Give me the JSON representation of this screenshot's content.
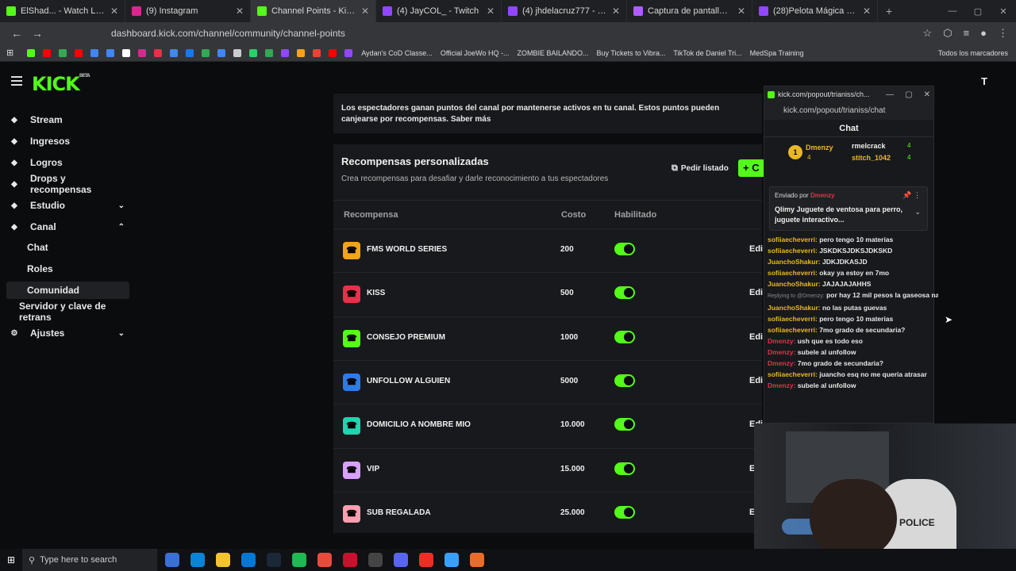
{
  "browser": {
    "tabs": [
      {
        "title": "ElShad... - Watch Live on",
        "fav": "#53fc18"
      },
      {
        "title": "(9) Instagram",
        "fav": "#d6298f"
      },
      {
        "title": "Channel Points - Kick Dashboar",
        "fav": "#53fc18"
      },
      {
        "title": "(4) JayCOL_ - Twitch",
        "fav": "#9146ff"
      },
      {
        "title": "(4) jhdelacruz777 - Twitch",
        "fav": "#9146ff"
      },
      {
        "title": "Captura de pantalla por Lightsh",
        "fav": "#b05cff"
      },
      {
        "title": "(28)Pelota Mágica para Perros",
        "fav": "#9146ff"
      }
    ],
    "url": "dashboard.kick.com/channel/community/channel-points",
    "bookmarks": [
      "Aydan's CoD Classe...",
      "Official JoeWo HQ -...",
      "ZOMBIE BAILANDO...",
      "Buy Tickets to Vibra...",
      "TikTok de Daniel Tri...",
      "MedSpa Training"
    ],
    "bookmarks_folder": "Todos los marcadores"
  },
  "sidebar": {
    "items": [
      {
        "label": "Stream",
        "icon": "broadcast-icon"
      },
      {
        "label": "Ingresos",
        "icon": "wallet-icon"
      },
      {
        "label": "Logros",
        "icon": "trophy-icon"
      },
      {
        "label": "Drops y recompensas",
        "icon": "gift-icon"
      },
      {
        "label": "Estudio",
        "icon": "studio-icon"
      },
      {
        "label": "Canal",
        "icon": "channel-icon"
      }
    ],
    "sub_items": [
      "Chat",
      "Roles",
      "Comunidad"
    ],
    "server_item": "Servidor y clave de retrans",
    "settings_item": "Ajustes"
  },
  "main": {
    "info": "Los espectadores ganan puntos del canal por mantenerse activos en tu canal. Estos puntos pueden canjearse por recompensas. Saber más",
    "card_title": "Recompensas personalizadas",
    "card_sub": "Crea recompensas para desafiar y darle reconocimiento a tus espectadores",
    "request_label": "Pedir listado",
    "create_label": "+ C",
    "columns": [
      "Recompensa",
      "Costo",
      "Habilitado"
    ],
    "rewards": [
      {
        "name": "FMS WORLD SERIES",
        "cost": "200",
        "color": "#f6a21b",
        "edit": "Edi"
      },
      {
        "name": "KISS",
        "cost": "500",
        "color": "#e8304a",
        "edit": "Edi"
      },
      {
        "name": "CONSEJO PREMIUM",
        "cost": "1000",
        "color": "#53fc18",
        "edit": "Edi"
      },
      {
        "name": "UNFOLLOW ALGUIEN",
        "cost": "5000",
        "color": "#2d7be8",
        "edit": "Edi"
      },
      {
        "name": "DOMICILIO A NOMBRE MIO",
        "cost": "10.000",
        "color": "#22d3b0",
        "edit": "Edi"
      },
      {
        "name": "VIP",
        "cost": "15.000",
        "color": "#d9a0ff",
        "edit": "E"
      },
      {
        "name": "SUB REGALADA",
        "cost": "25.000",
        "color": "#ff9eb0",
        "edit": "E"
      }
    ]
  },
  "chat_popup": {
    "window_title": "kick.com/popout/trianiss/ch...",
    "url": "kick.com/popout/trianiss/chat",
    "title": "Chat",
    "leaders": {
      "first": {
        "name": "Dmenzy",
        "points": "4",
        "rank": "1"
      },
      "others": [
        {
          "name": "rmelcrack",
          "points": "4"
        },
        {
          "name": "stitch_1042",
          "points": "4"
        }
      ]
    },
    "pinned": {
      "by_label": "Enviado por",
      "by_user": "Dmenzy",
      "text": "Qlimy Juguete de ventosa para perro, juguete interactivo..."
    },
    "messages": [
      {
        "user": "sofiiaecheverri:",
        "text": " pero tengo 10 materias",
        "cls": "u"
      },
      {
        "user": "sofiiaecheverri:",
        "text": " JSKDKSJDKSJDKSKD",
        "cls": "u"
      },
      {
        "user": "JuanchoShakur:",
        "text": " JDKJDKASJD",
        "cls": "u"
      },
      {
        "user": "sofiiaecheverri:",
        "text": " okay ya estoy en 7mo",
        "cls": "u"
      },
      {
        "user": "JuanchoShakur:",
        "text": " JAJAJAJAHHS",
        "cls": "u"
      },
      {
        "user": "Replying to @Dmenzy:",
        "text": " por hay 12 mil pesos la gaseosa nada mas",
        "cls": "reply"
      },
      {
        "user": "JuanchoShakur:",
        "text": " no las putas guevas",
        "cls": "u"
      },
      {
        "user": "sofiiaecheverri:",
        "text": " pero tengo 10 materias",
        "cls": "u"
      },
      {
        "user": "sofiiaecheverri:",
        "text": " 7mo grado de secundaria?",
        "cls": "u"
      },
      {
        "user": "Dmenzy:",
        "text": " ush que es todo eso",
        "cls": "u4"
      },
      {
        "user": "Dmenzy:",
        "text": " subele al unfollow",
        "cls": "u4"
      },
      {
        "user": "Dmenzy:",
        "text": " 7mo grado de secundaria?",
        "cls": "u4"
      },
      {
        "user": "sofiiaecheverri:",
        "text": " juancho esq no me queria atrasar",
        "cls": "u"
      },
      {
        "user": "Dmenzy:",
        "text": " subele al unfollow",
        "cls": "u4"
      }
    ]
  },
  "webcam": {
    "chair_label": "POLICE"
  },
  "taskbar": {
    "search_placeholder": "Type here to search"
  }
}
